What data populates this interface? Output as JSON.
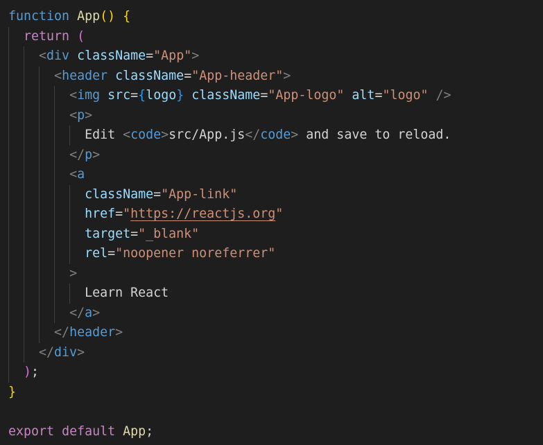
{
  "colors": {
    "background": "#1e1e1e",
    "keyword": "#569cd6",
    "control_keyword": "#c586c0",
    "function_name": "#dcdcaa",
    "brace": "#ffd700",
    "paren": "#da70d6",
    "bracket": "#179fff",
    "punctuation": "#808080",
    "attribute": "#9cdcfe",
    "string": "#ce9178",
    "text": "#d4d4d4",
    "indent_guide": "#404040"
  },
  "lines": [
    [
      {
        "t": "function",
        "c": "keyword"
      },
      {
        "t": " ",
        "c": "text"
      },
      {
        "t": "App",
        "c": "func"
      },
      {
        "t": "()",
        "c": "brace"
      },
      {
        "t": " ",
        "c": "text"
      },
      {
        "t": "{",
        "c": "brace"
      }
    ],
    [
      {
        "t": "  ",
        "c": "text"
      },
      {
        "t": "return",
        "c": "control"
      },
      {
        "t": " ",
        "c": "text"
      },
      {
        "t": "(",
        "c": "paren"
      }
    ],
    [
      {
        "t": "    ",
        "c": "text"
      },
      {
        "t": "<",
        "c": "punct"
      },
      {
        "t": "div",
        "c": "tag"
      },
      {
        "t": " ",
        "c": "text"
      },
      {
        "t": "className",
        "c": "attr"
      },
      {
        "t": "=",
        "c": "text"
      },
      {
        "t": "\"App\"",
        "c": "string"
      },
      {
        "t": ">",
        "c": "punct"
      }
    ],
    [
      {
        "t": "      ",
        "c": "text"
      },
      {
        "t": "<",
        "c": "punct"
      },
      {
        "t": "header",
        "c": "tag"
      },
      {
        "t": " ",
        "c": "text"
      },
      {
        "t": "className",
        "c": "attr"
      },
      {
        "t": "=",
        "c": "text"
      },
      {
        "t": "\"App-header\"",
        "c": "string"
      },
      {
        "t": ">",
        "c": "punct"
      }
    ],
    [
      {
        "t": "        ",
        "c": "text"
      },
      {
        "t": "<",
        "c": "punct"
      },
      {
        "t": "img",
        "c": "tag"
      },
      {
        "t": " ",
        "c": "text"
      },
      {
        "t": "src",
        "c": "attr"
      },
      {
        "t": "=",
        "c": "text"
      },
      {
        "t": "{",
        "c": "bracket"
      },
      {
        "t": "logo",
        "c": "attr"
      },
      {
        "t": "}",
        "c": "bracket"
      },
      {
        "t": " ",
        "c": "text"
      },
      {
        "t": "className",
        "c": "attr"
      },
      {
        "t": "=",
        "c": "text"
      },
      {
        "t": "\"App-logo\"",
        "c": "string"
      },
      {
        "t": " ",
        "c": "text"
      },
      {
        "t": "alt",
        "c": "attr"
      },
      {
        "t": "=",
        "c": "text"
      },
      {
        "t": "\"logo\"",
        "c": "string"
      },
      {
        "t": " ",
        "c": "text"
      },
      {
        "t": "/>",
        "c": "punct"
      }
    ],
    [
      {
        "t": "        ",
        "c": "text"
      },
      {
        "t": "<",
        "c": "punct"
      },
      {
        "t": "p",
        "c": "tag"
      },
      {
        "t": ">",
        "c": "punct"
      }
    ],
    [
      {
        "t": "          ",
        "c": "text"
      },
      {
        "t": "Edit ",
        "c": "text"
      },
      {
        "t": "<",
        "c": "punct"
      },
      {
        "t": "code",
        "c": "tag"
      },
      {
        "t": ">",
        "c": "punct"
      },
      {
        "t": "src/App.js",
        "c": "text"
      },
      {
        "t": "</",
        "c": "punct"
      },
      {
        "t": "code",
        "c": "tag"
      },
      {
        "t": ">",
        "c": "punct"
      },
      {
        "t": " and save to reload.",
        "c": "text"
      }
    ],
    [
      {
        "t": "        ",
        "c": "text"
      },
      {
        "t": "</",
        "c": "punct"
      },
      {
        "t": "p",
        "c": "tag"
      },
      {
        "t": ">",
        "c": "punct"
      }
    ],
    [
      {
        "t": "        ",
        "c": "text"
      },
      {
        "t": "<",
        "c": "punct"
      },
      {
        "t": "a",
        "c": "tag"
      }
    ],
    [
      {
        "t": "          ",
        "c": "text"
      },
      {
        "t": "className",
        "c": "attr"
      },
      {
        "t": "=",
        "c": "text"
      },
      {
        "t": "\"App-link\"",
        "c": "string"
      }
    ],
    [
      {
        "t": "          ",
        "c": "text"
      },
      {
        "t": "href",
        "c": "attr"
      },
      {
        "t": "=",
        "c": "text"
      },
      {
        "t": "\"",
        "c": "string"
      },
      {
        "t": "https://reactjs.org",
        "c": "link"
      },
      {
        "t": "\"",
        "c": "string"
      }
    ],
    [
      {
        "t": "          ",
        "c": "text"
      },
      {
        "t": "target",
        "c": "attr"
      },
      {
        "t": "=",
        "c": "text"
      },
      {
        "t": "\"_blank\"",
        "c": "string"
      }
    ],
    [
      {
        "t": "          ",
        "c": "text"
      },
      {
        "t": "rel",
        "c": "attr"
      },
      {
        "t": "=",
        "c": "text"
      },
      {
        "t": "\"noopener noreferrer\"",
        "c": "string"
      }
    ],
    [
      {
        "t": "        ",
        "c": "text"
      },
      {
        "t": ">",
        "c": "punct"
      }
    ],
    [
      {
        "t": "          ",
        "c": "text"
      },
      {
        "t": "Learn React",
        "c": "text"
      }
    ],
    [
      {
        "t": "        ",
        "c": "text"
      },
      {
        "t": "</",
        "c": "punct"
      },
      {
        "t": "a",
        "c": "tag"
      },
      {
        "t": ">",
        "c": "punct"
      }
    ],
    [
      {
        "t": "      ",
        "c": "text"
      },
      {
        "t": "</",
        "c": "punct"
      },
      {
        "t": "header",
        "c": "tag"
      },
      {
        "t": ">",
        "c": "punct"
      }
    ],
    [
      {
        "t": "    ",
        "c": "text"
      },
      {
        "t": "</",
        "c": "punct"
      },
      {
        "t": "div",
        "c": "tag"
      },
      {
        "t": ">",
        "c": "punct"
      }
    ],
    [
      {
        "t": "  ",
        "c": "text"
      },
      {
        "t": ")",
        "c": "paren"
      },
      {
        "t": ";",
        "c": "text"
      }
    ],
    [
      {
        "t": "}",
        "c": "brace"
      }
    ],
    [],
    [
      {
        "t": "export",
        "c": "control"
      },
      {
        "t": " ",
        "c": "text"
      },
      {
        "t": "default",
        "c": "control"
      },
      {
        "t": " ",
        "c": "text"
      },
      {
        "t": "App",
        "c": "func"
      },
      {
        "t": ";",
        "c": "text"
      }
    ]
  ]
}
